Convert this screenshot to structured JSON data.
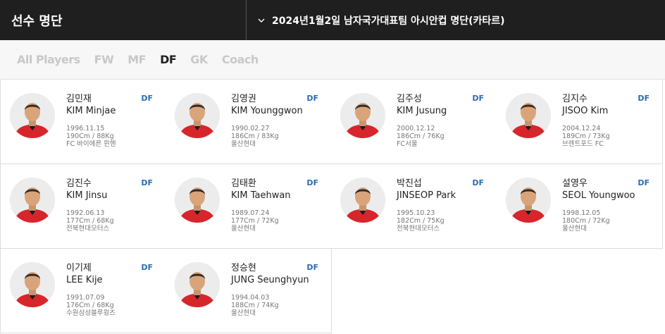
{
  "header": {
    "section_title": "선수 명단",
    "roster_select": "2024년1월2일 남자국가대표팀 아시안컵 명단(카타르)"
  },
  "tabs": [
    {
      "label": "All Players",
      "active": false
    },
    {
      "label": "FW",
      "active": false
    },
    {
      "label": "MF",
      "active": false
    },
    {
      "label": "DF",
      "active": true
    },
    {
      "label": "GK",
      "active": false
    },
    {
      "label": "Coach",
      "active": false
    }
  ],
  "colors": {
    "header_bg": "#1f1f1f",
    "active_tab": "#222222",
    "inactive_tab": "#c8c8c8",
    "position_badge": "#2b6cb0",
    "jersey_red": "#d7262b"
  },
  "players": [
    {
      "name_ko": "김민재",
      "name_en": "KIM Minjae",
      "birth": "1996.11.15",
      "body": "190Cm / 88Kg",
      "club": "FC 바이에른 뮌헨",
      "position": "DF"
    },
    {
      "name_ko": "김영권",
      "name_en": "KIM Younggwon",
      "birth": "1990.02.27",
      "body": "186Cm / 83Kg",
      "club": "울산현대",
      "position": "DF"
    },
    {
      "name_ko": "김주성",
      "name_en": "KIM Jusung",
      "birth": "2000.12.12",
      "body": "186Cm / 76Kg",
      "club": "FC서울",
      "position": "DF"
    },
    {
      "name_ko": "김지수",
      "name_en": "JISOO Kim",
      "birth": "2004.12.24",
      "body": "189Cm / 73Kg",
      "club": "브렌트포드 FC",
      "position": "DF"
    },
    {
      "name_ko": "김진수",
      "name_en": "KIM Jinsu",
      "birth": "1992.06.13",
      "body": "177Cm / 68Kg",
      "club": "전북현대모터스",
      "position": "DF"
    },
    {
      "name_ko": "김태환",
      "name_en": "KIM Taehwan",
      "birth": "1989.07.24",
      "body": "177Cm / 72Kg",
      "club": "울산현대",
      "position": "DF"
    },
    {
      "name_ko": "박진섭",
      "name_en": "JINSEOP Park",
      "birth": "1995.10.23",
      "body": "182Cm / 75Kg",
      "club": "전북현대모터스",
      "position": "DF"
    },
    {
      "name_ko": "설영우",
      "name_en": "SEOL Youngwoo",
      "birth": "1998.12.05",
      "body": "180Cm / 72Kg",
      "club": "울산현대",
      "position": "DF"
    },
    {
      "name_ko": "이기제",
      "name_en": "LEE Kije",
      "birth": "1991.07.09",
      "body": "176Cm / 68Kg",
      "club": "수원삼성블루윙즈",
      "position": "DF"
    },
    {
      "name_ko": "정승현",
      "name_en": "JUNG Seunghyun",
      "birth": "1994.04.03",
      "body": "188Cm / 74Kg",
      "club": "울산현대",
      "position": "DF"
    }
  ]
}
